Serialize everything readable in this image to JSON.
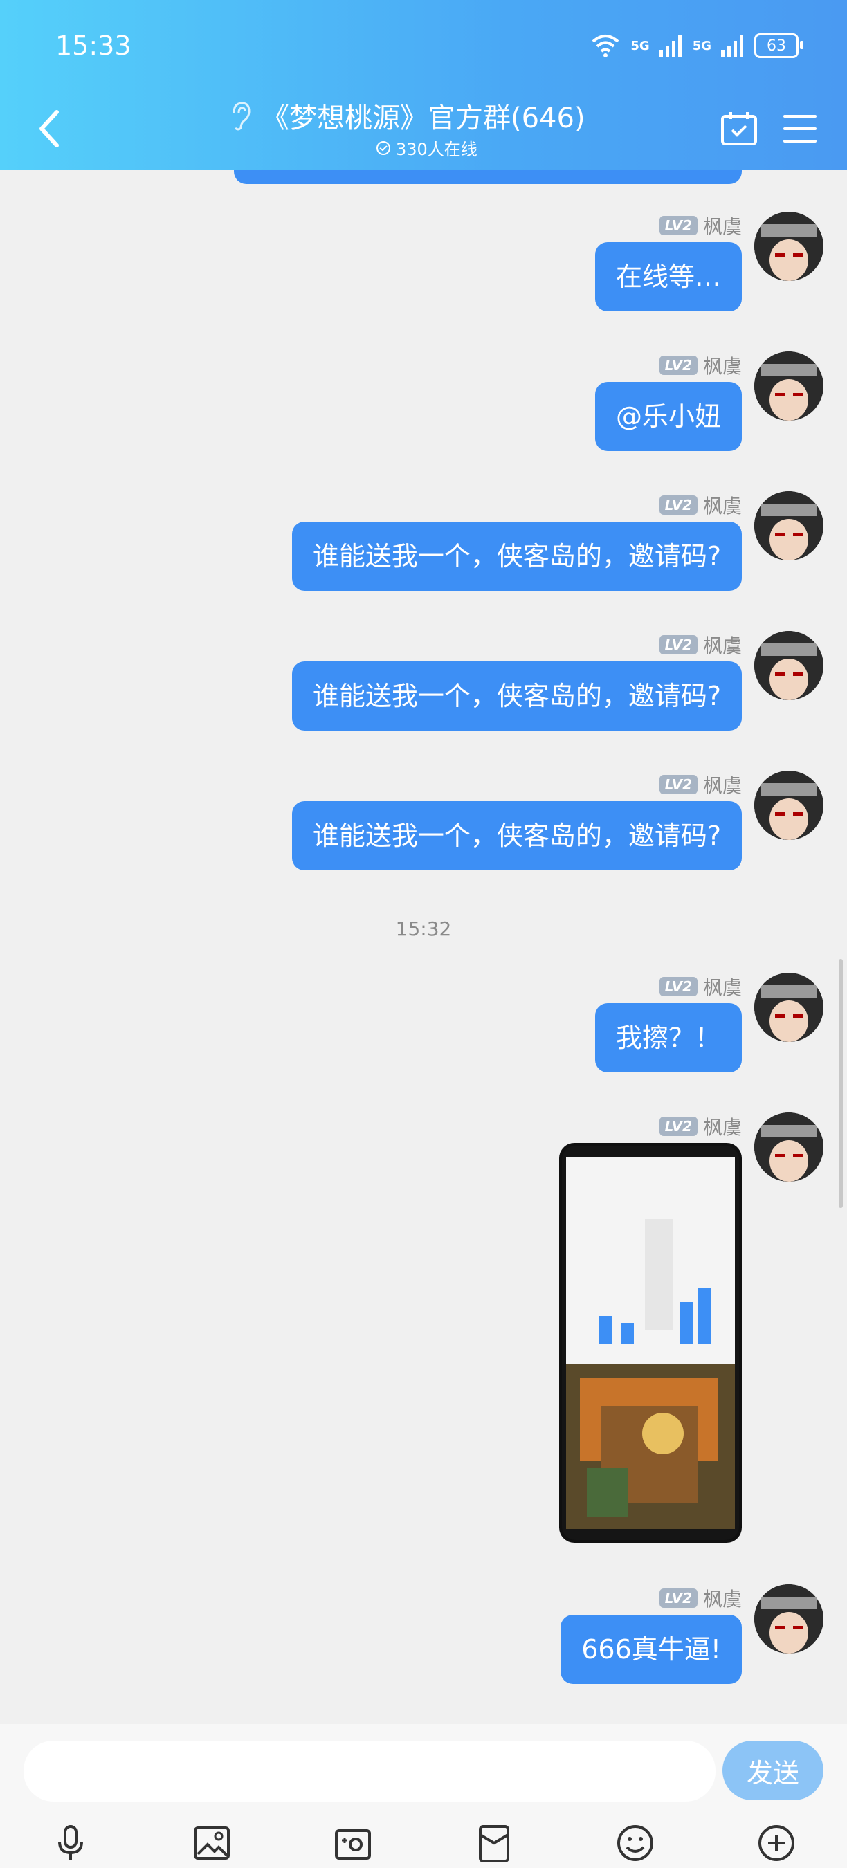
{
  "status": {
    "time": "15:33",
    "signal1": "5G",
    "signal2": "5G",
    "battery": "63"
  },
  "header": {
    "title": "《梦想桃源》官方群(646)",
    "online": "330人在线"
  },
  "messages": [
    {
      "sender": "枫虞",
      "level": "LV2",
      "text": "在线等…"
    },
    {
      "sender": "枫虞",
      "level": "LV2",
      "text": "@乐小妞"
    },
    {
      "sender": "枫虞",
      "level": "LV2",
      "text": "谁能送我一个，侠客岛的，邀请码?"
    },
    {
      "sender": "枫虞",
      "level": "LV2",
      "text": "谁能送我一个，侠客岛的，邀请码?"
    },
    {
      "sender": "枫虞",
      "level": "LV2",
      "text": "谁能送我一个，侠客岛的，邀请码?"
    },
    {
      "sender": "枫虞",
      "level": "LV2",
      "text": "我擦？！"
    },
    {
      "sender": "枫虞",
      "level": "LV2",
      "text": ""
    },
    {
      "sender": "枫虞",
      "level": "LV2",
      "text": "666真牛逼!"
    }
  ],
  "time_separator": "15:32",
  "input": {
    "placeholder": "",
    "send_label": "发送"
  },
  "toolbar": [
    "microphone-icon",
    "image-icon",
    "camera-icon",
    "red-packet-icon",
    "emoji-icon",
    "plus-icon"
  ],
  "colors": {
    "bubble": "#3d8ff5",
    "header_start": "#55d0fa",
    "header_end": "#4a9af2",
    "send_button": "#8cc4f6"
  }
}
